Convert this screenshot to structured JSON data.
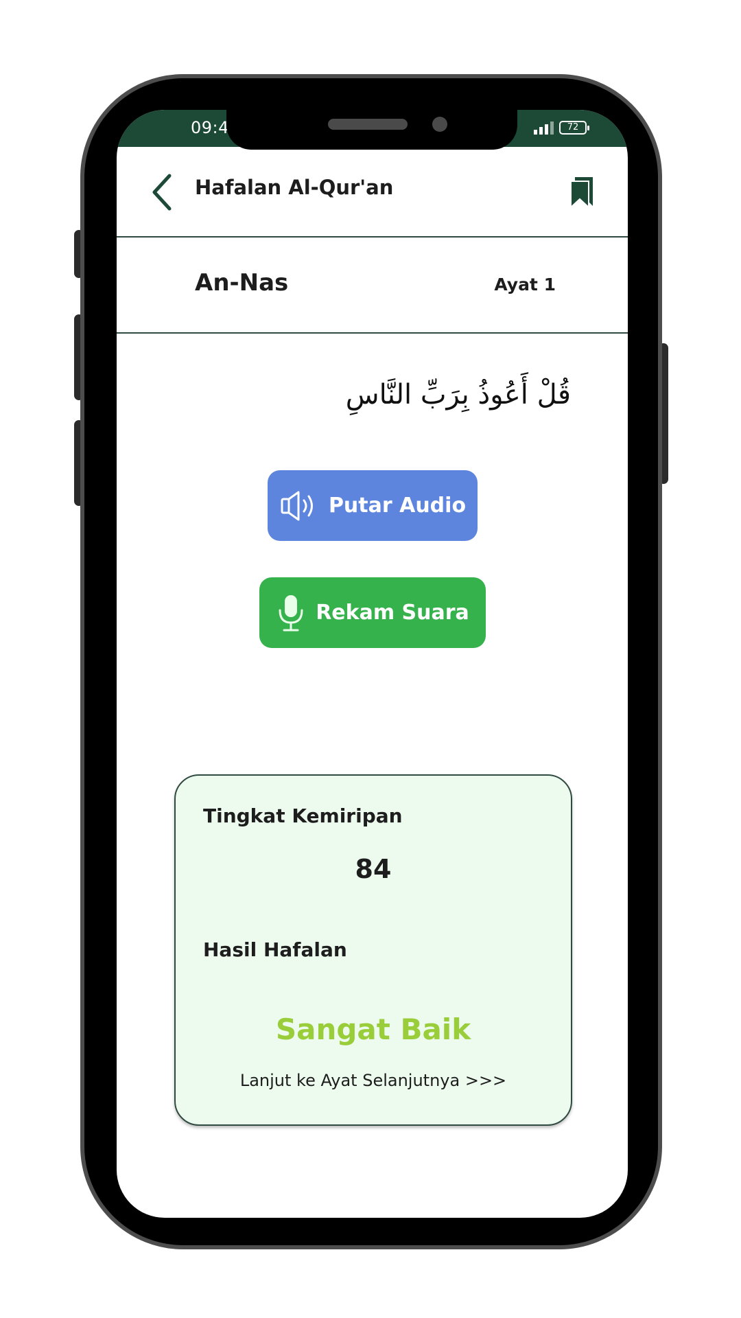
{
  "status_bar": {
    "time": "09:4",
    "battery": "72"
  },
  "header": {
    "title": "Hafalan Al-Qur'an",
    "back_icon": "chevron-left-icon",
    "bookmark_icon": "bookmark-icon"
  },
  "surah": {
    "name": "An-Nas",
    "ayat_label": "Ayat 1"
  },
  "verse": {
    "arabic": "قُلْ أَعُوذُ بِرَبِّ النَّاسِ"
  },
  "actions": {
    "play_audio_label": "Putar Audio",
    "play_audio_icon": "speaker-icon",
    "play_audio_color": "#5d85dd",
    "record_label": "Rekam Suara",
    "record_icon": "microphone-icon",
    "record_color": "#36b24c"
  },
  "result": {
    "similarity_label": "Tingkat Kemiripan",
    "similarity_value": "84",
    "result_label": "Hasil Hafalan",
    "grade": "Sangat Baik",
    "grade_color": "#9acd3a",
    "next_link": "Lanjut ke Ayat Selanjutnya >>>"
  },
  "theme": {
    "primary_dark": "#1c4a36",
    "card_background": "#edfbee"
  }
}
